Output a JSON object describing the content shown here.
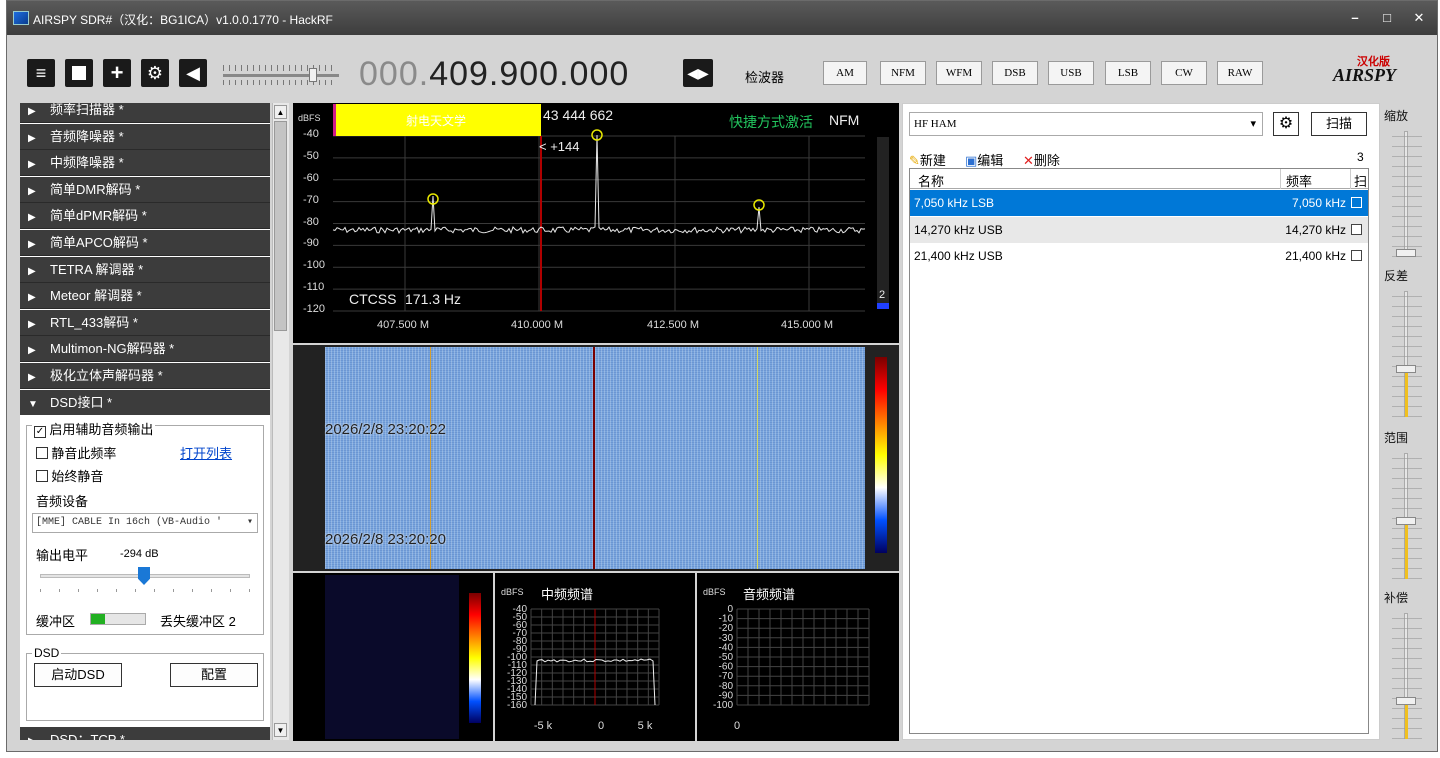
{
  "window": {
    "title": "AIRSPY SDR#（汉化：BG1ICA）v1.0.0.1770 - HackRF",
    "min_label": "–",
    "max_label": "□",
    "close_label": "✕"
  },
  "toolbar": {
    "icons": [
      "menu-icon",
      "stop-icon",
      "add-icon",
      "gear-icon",
      "speaker-icon"
    ],
    "freq_dim": "000.",
    "freq_main": "409.900.000",
    "detector_label": "检波器",
    "modes": [
      "AM",
      "NFM",
      "WFM",
      "DSB",
      "USB",
      "LSB",
      "CW",
      "RAW"
    ],
    "logo_top": "汉化版",
    "logo_main": "AIRSPY"
  },
  "sidebar": {
    "sections": [
      {
        "label": "频率扫描器 *",
        "expanded": false
      },
      {
        "label": "音频降噪器 *",
        "expanded": false
      },
      {
        "label": "中频降噪器 *",
        "expanded": false
      },
      {
        "label": "简单DMR解码 *",
        "expanded": false
      },
      {
        "label": "简单dPMR解码 *",
        "expanded": false
      },
      {
        "label": "简单APCO解码 *",
        "expanded": false
      },
      {
        "label": "TETRA 解调器 *",
        "expanded": false
      },
      {
        "label": "Meteor 解调器 *",
        "expanded": false
      },
      {
        "label": "RTL_433解码 *",
        "expanded": false
      },
      {
        "label": "Multimon-NG解码器 *",
        "expanded": false
      },
      {
        "label": "极化立体声解码器 *",
        "expanded": false
      },
      {
        "label": "DSD接口 *",
        "expanded": true
      }
    ],
    "dsd": {
      "aux_audio_label": "启用辅助音频输出",
      "mute_freq_label": "静音此频率",
      "open_list_link": "打开列表",
      "always_mute_label": "始终静音",
      "audio_device_label": "音频设备",
      "audio_device_value": "[MME] CABLE In 16ch (VB-Audio '",
      "output_level_label": "输出电平",
      "output_level_value": "-294 dB",
      "buffer_label": "缓冲区",
      "buffer_fill": 0.25,
      "lost_buffer_label": "丢失缓冲区",
      "lost_buffer_value": "2",
      "group_label": "DSD",
      "start_button": "启动DSD",
      "config_button": "配置"
    },
    "bottom_section": "DSD：TCP *"
  },
  "spectrum": {
    "unit": "dBFS",
    "y_ticks": [
      "-40",
      "-50",
      "-60",
      "-70",
      "-80",
      "-90",
      "-100",
      "-110",
      "-120"
    ],
    "x_ticks": [
      "407.500 M",
      "410.000 M",
      "412.500 M",
      "415.000 M"
    ],
    "banner_label": "射电天文学",
    "readout": "43 444 662",
    "offset": "< +144",
    "shortcut_label": "快捷方式激活",
    "mode_label": "NFM",
    "ctcss": "CTCSS",
    "ctcss_value": "171.3 Hz",
    "side_value": "2"
  },
  "waterfall": {
    "time1": "2026/2/8 23:20:22",
    "time2": "2026/2/8 23:20:20"
  },
  "if_spectrum": {
    "unit": "dBFS",
    "title": "中频频谱",
    "y_ticks": [
      "-40",
      "-50",
      "-60",
      "-70",
      "-80",
      "-90",
      "-100",
      "-110",
      "-120",
      "-130",
      "-140",
      "-150",
      "-160"
    ],
    "x_ticks": [
      "-5 k",
      "0",
      "5 k"
    ]
  },
  "audio_spectrum": {
    "unit": "dBFS",
    "title": "音频频谱",
    "y_ticks": [
      "0",
      "-10",
      "-20",
      "-30",
      "-40",
      "-50",
      "-60",
      "-70",
      "-80",
      "-90",
      "-100"
    ],
    "x_ticks": [
      "0"
    ]
  },
  "freqmgr": {
    "group_value": "HF HAM",
    "scan_button": "扫描",
    "new_label": "新建",
    "edit_label": "编辑",
    "delete_label": "删除",
    "count": "3",
    "columns": [
      "名称",
      "频率",
      "扫"
    ],
    "rows": [
      {
        "name": "7,050 kHz LSB",
        "freq": "7,050 kHz",
        "selected": true
      },
      {
        "name": "14,270 kHz USB",
        "freq": "14,270 kHz",
        "selected": false
      },
      {
        "name": "21,400 kHz USB",
        "freq": "21,400 kHz",
        "selected": false
      }
    ]
  },
  "right_sliders": {
    "labels": [
      "缩放",
      "反差",
      "范围",
      "补偿"
    ]
  },
  "colors": {
    "spectrum_bg": "#000000",
    "waterfall_bg": "#7aa6de",
    "banner_yellow": "#ffff00",
    "selected_row": "#0078d7",
    "center_line": "#b00000"
  }
}
